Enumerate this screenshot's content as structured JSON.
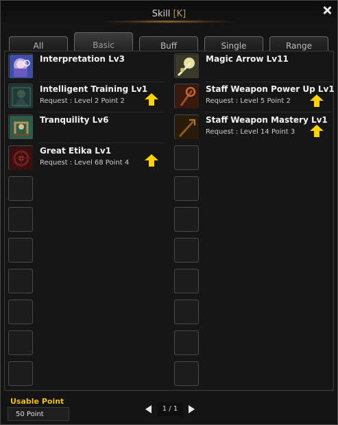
{
  "window": {
    "title": "Skill",
    "hotkey": "[K]"
  },
  "tabs": [
    {
      "label": "All"
    },
    {
      "label": "Basic"
    },
    {
      "label": "Buff"
    },
    {
      "label": "Single"
    },
    {
      "label": "Range"
    }
  ],
  "active_tab": "Basic",
  "skills_left": [
    {
      "name": "Interpretation Lv3",
      "icon": "interpretation-skill-icon",
      "request": "",
      "upgradable": false
    },
    {
      "name": "Intelligent Training Lv1",
      "icon": "intelligent-training-skill-icon",
      "request": "Request : Level  2   Point  2",
      "upgradable": true
    },
    {
      "name": "Tranquility Lv6",
      "icon": "tranquility-skill-icon",
      "request": "",
      "upgradable": false
    },
    {
      "name": "Great Etika Lv1",
      "icon": "great-etika-skill-icon",
      "request": "Request : Level 68   Point  4",
      "upgradable": true
    }
  ],
  "skills_right": [
    {
      "name": "Magic Arrow Lv11",
      "icon": "magic-arrow-skill-icon",
      "request": "",
      "upgradable": false
    },
    {
      "name": "Staff Weapon Power Up Lv1",
      "icon": "staff-weapon-power-up-skill-icon",
      "request": "Request : Level  5   Point  2",
      "upgradable": true
    },
    {
      "name": "Staff Weapon Mastery Lv1",
      "icon": "staff-weapon-mastery-skill-icon",
      "request": "Request : Level 14   Point  3",
      "upgradable": true
    }
  ],
  "footer": {
    "usable_point_label": "Usable Point",
    "usable_point_value": "50 Point"
  },
  "pager": {
    "text": "1 / 1"
  },
  "colors": {
    "usable_label": "#f0c020",
    "up_arrow": "#ffd200"
  }
}
